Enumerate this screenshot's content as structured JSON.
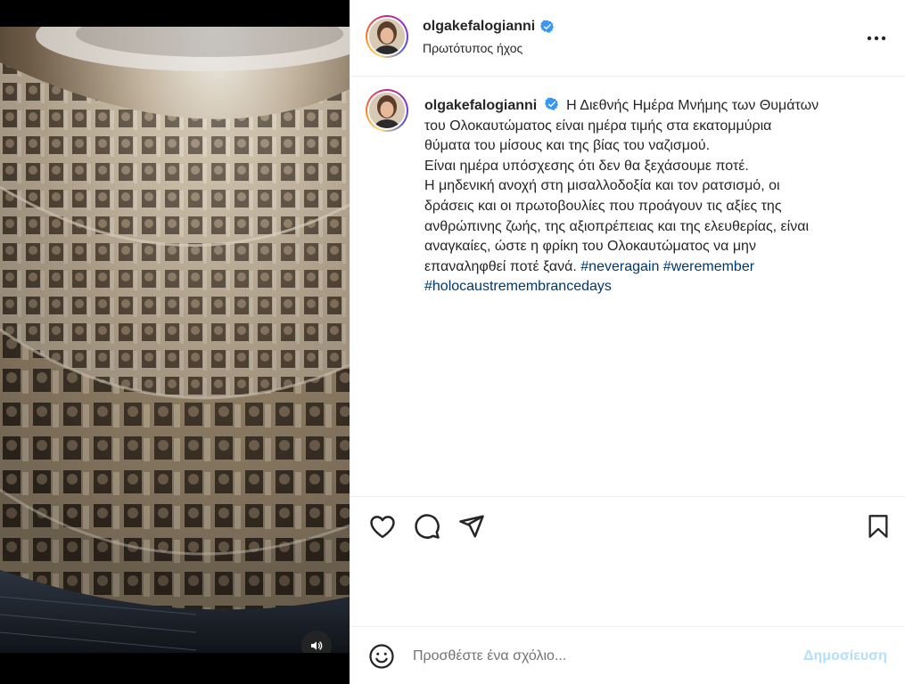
{
  "post": {
    "username": "olgakefalogianni",
    "audio_label": "Πρωτότυπος ήχος",
    "caption_lines": [
      "Η Διεθνής Ημέρα Μνήμης των Θυμάτων",
      "του Ολοκαυτώματος είναι ημέρα τιμής στα εκατομμύρια",
      "θύματα του μίσους και της βίας του ναζισμού.",
      "Είναι ημέρα υπόσχεσης ότι δεν θα ξεχάσουμε ποτέ.",
      "Η μηδενική ανοχή στη μισαλλοδοξία και τον ρατσισμό, οι",
      "δράσεις και οι πρωτοβουλίες που προάγουν τις αξίες της",
      "ανθρώπινης ζωής, της αξιοπρέπειας και της ελευθερίας, είναι",
      "αναγκαίες, ώστε η φρίκη του Ολοκαυτώματος να μην",
      "επαναληφθεί ποτέ ξανά."
    ],
    "hashtags": [
      "#neveragain",
      "#weremember",
      "#holocaustremembrancedays"
    ]
  },
  "comment_bar": {
    "placeholder": "Προσθέστε ένα σχόλιο...",
    "post_label": "Δημοσίευση"
  },
  "icons": {
    "verified": "verified-badge-icon",
    "more": "more-options-icon",
    "like": "heart-icon",
    "comment": "comment-icon",
    "share": "send-icon",
    "save": "bookmark-icon",
    "emoji": "emoji-icon",
    "mute": "speaker-icon"
  },
  "colors": {
    "verified_blue": "#3897f0",
    "hashtag": "#00376b",
    "post_button_disabled": "#b2dffc"
  }
}
